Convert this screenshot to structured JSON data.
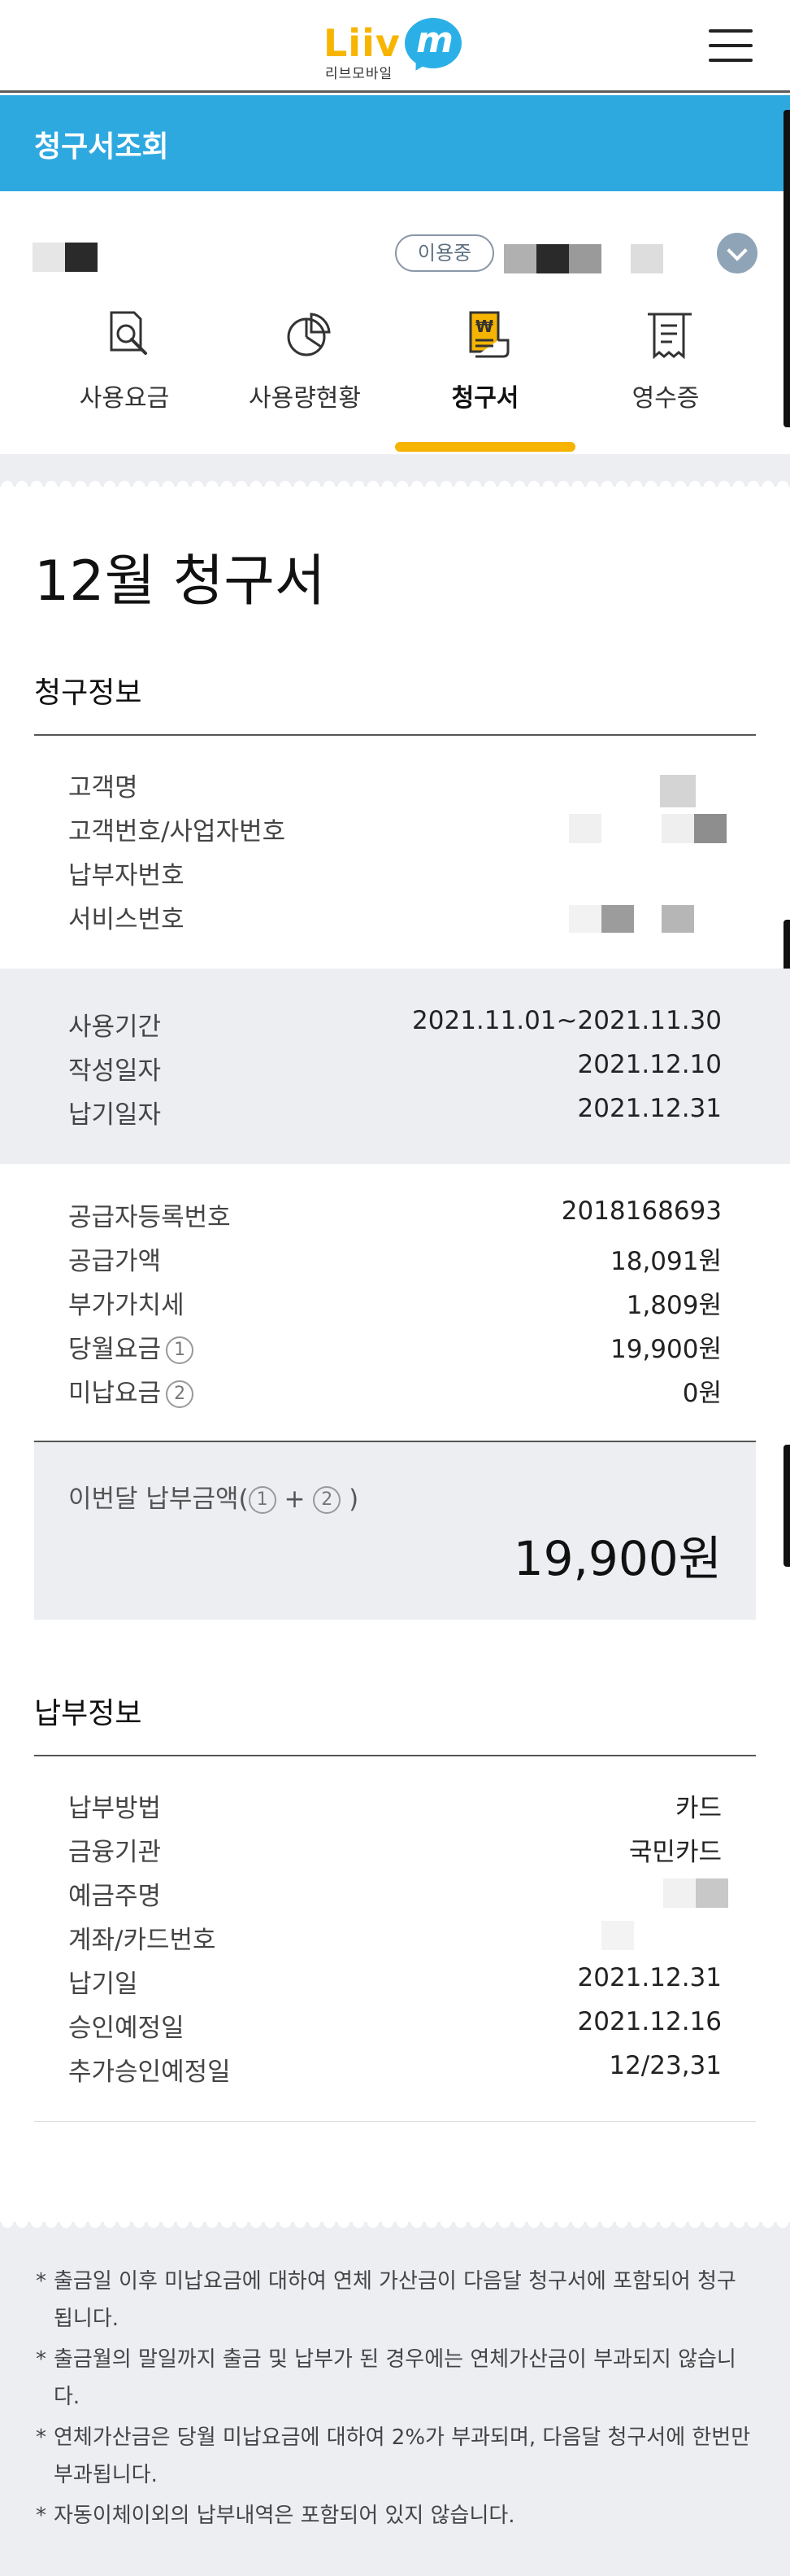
{
  "header": {
    "logo_text": "Liiv",
    "logo_m": "m",
    "logo_sub": "리브모바일",
    "menu_icon": "hamburger-menu-icon"
  },
  "page": {
    "title": "청구서조회"
  },
  "line_selector": {
    "status": "이용중",
    "dropdown_icon": "chevron-down-icon"
  },
  "tabs": [
    {
      "label": "사용요금",
      "icon": "search-document-icon"
    },
    {
      "label": "사용량현황",
      "icon": "pie-chart-icon"
    },
    {
      "label": "청구서",
      "icon": "won-bill-icon",
      "active": true
    },
    {
      "label": "영수증",
      "icon": "receipt-icon"
    }
  ],
  "bill": {
    "title": "12월 청구서",
    "billing_info": {
      "heading": "청구정보",
      "customer": [
        {
          "label": "고객명"
        },
        {
          "label": "고객번호/사업자번호"
        },
        {
          "label": "납부자번호"
        },
        {
          "label": "서비스번호"
        }
      ],
      "period": [
        {
          "label": "사용기간",
          "value": "2021.11.01~2021.11.30"
        },
        {
          "label": "작성일자",
          "value": "2021.12.10"
        },
        {
          "label": "납기일자",
          "value": "2021.12.31"
        }
      ],
      "amounts": [
        {
          "label": "공급자등록번호",
          "value": "2018168693"
        },
        {
          "label": "공급가액",
          "value": "18,091원"
        },
        {
          "label": "부가가치세",
          "value": "1,809원"
        },
        {
          "label": "당월요금",
          "mark": "1",
          "value": "19,900원"
        },
        {
          "label": "미납요금",
          "mark": "2",
          "value": "0원"
        }
      ],
      "total": {
        "label_prefix": "이번달 납부금액(",
        "mark1": "1",
        "plus": " + ",
        "mark2": "2",
        "label_suffix": " )",
        "value": "19,900원"
      }
    },
    "payment_info": {
      "heading": "납부정보",
      "rows": [
        {
          "label": "납부방법",
          "value": "카드"
        },
        {
          "label": "금융기관",
          "value": "국민카드"
        },
        {
          "label": "예금주명",
          "value": ""
        },
        {
          "label": "계좌/카드번호",
          "value": ""
        },
        {
          "label": "납기일",
          "value": "2021.12.31"
        },
        {
          "label": "승인예정일",
          "value": "2021.12.16"
        },
        {
          "label": "추가승인예정일",
          "value": "12/23,31"
        }
      ]
    }
  },
  "notes": [
    {
      "star": "*",
      "text": "출금일 이후 미납요금에 대하여 연체 가산금이 다음달 청구서에 포함되어 청구됩니다."
    },
    {
      "star": "*",
      "text": "출금월의 말일까지 출금 및 납부가 된 경우에는 연체가산금이 부과되지 않습니다."
    },
    {
      "star": "*",
      "text": "연체가산금은 당월 미납요금에 대하여 2%가 부과되며, 다음달 청구서에 한번만 부과됩니다."
    },
    {
      "star": "*",
      "text": "자동이체이외의 납부내역은 포함되어 있지 않습니다."
    }
  ],
  "colors": {
    "brand_blue": "#2ea9e0",
    "tab_indicator": "#f6b400",
    "logo_yellow": "#f7b500",
    "section_gray": "#eceef2"
  }
}
